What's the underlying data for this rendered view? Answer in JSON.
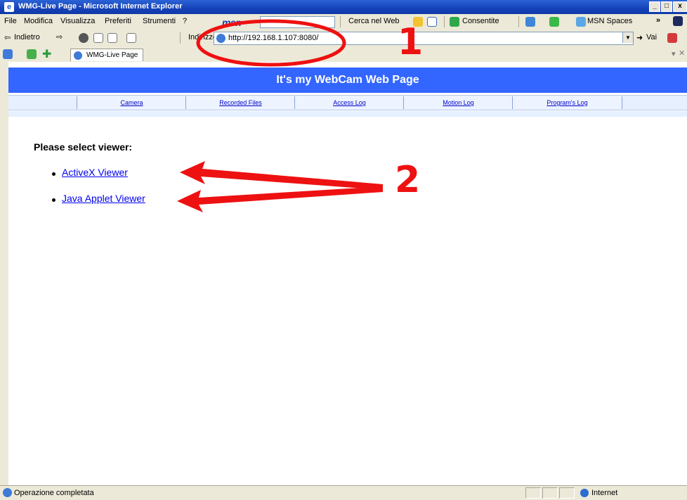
{
  "window": {
    "title": "WMG-Live Page - Microsoft Internet Explorer"
  },
  "menu": [
    "File",
    "Modifica",
    "Visualizza",
    "Preferiti",
    "Strumenti",
    "?"
  ],
  "toolbar": {
    "msn_logo": "msn",
    "search_label": "Cerca nel Web",
    "popup_label": "Consentite",
    "spaces_label": "MSN Spaces"
  },
  "nav": {
    "back_label": "Indietro",
    "address_label": "Indirizzo",
    "address_value": "http://192.168.1.107:8080/",
    "go_label": "Vai"
  },
  "tab": {
    "label": "WMG-Live Page"
  },
  "page": {
    "banner_title": "It's my WebCam Web Page",
    "nav_links": [
      "Camera",
      "Recorded Files",
      "Access Log",
      "Motion Log",
      "Program's Log"
    ],
    "prompt": "Please select viewer:",
    "viewers": [
      "ActiveX Viewer",
      "Java Applet Viewer"
    ]
  },
  "status": {
    "text": "Operazione completata",
    "zone": "Internet"
  },
  "annotations": {
    "label_1": "1",
    "label_2": "2",
    "color": "#ee1111"
  },
  "colors": {
    "banner": "#3366ff",
    "link": "#0000ee",
    "chrome": "#ece9d8"
  }
}
